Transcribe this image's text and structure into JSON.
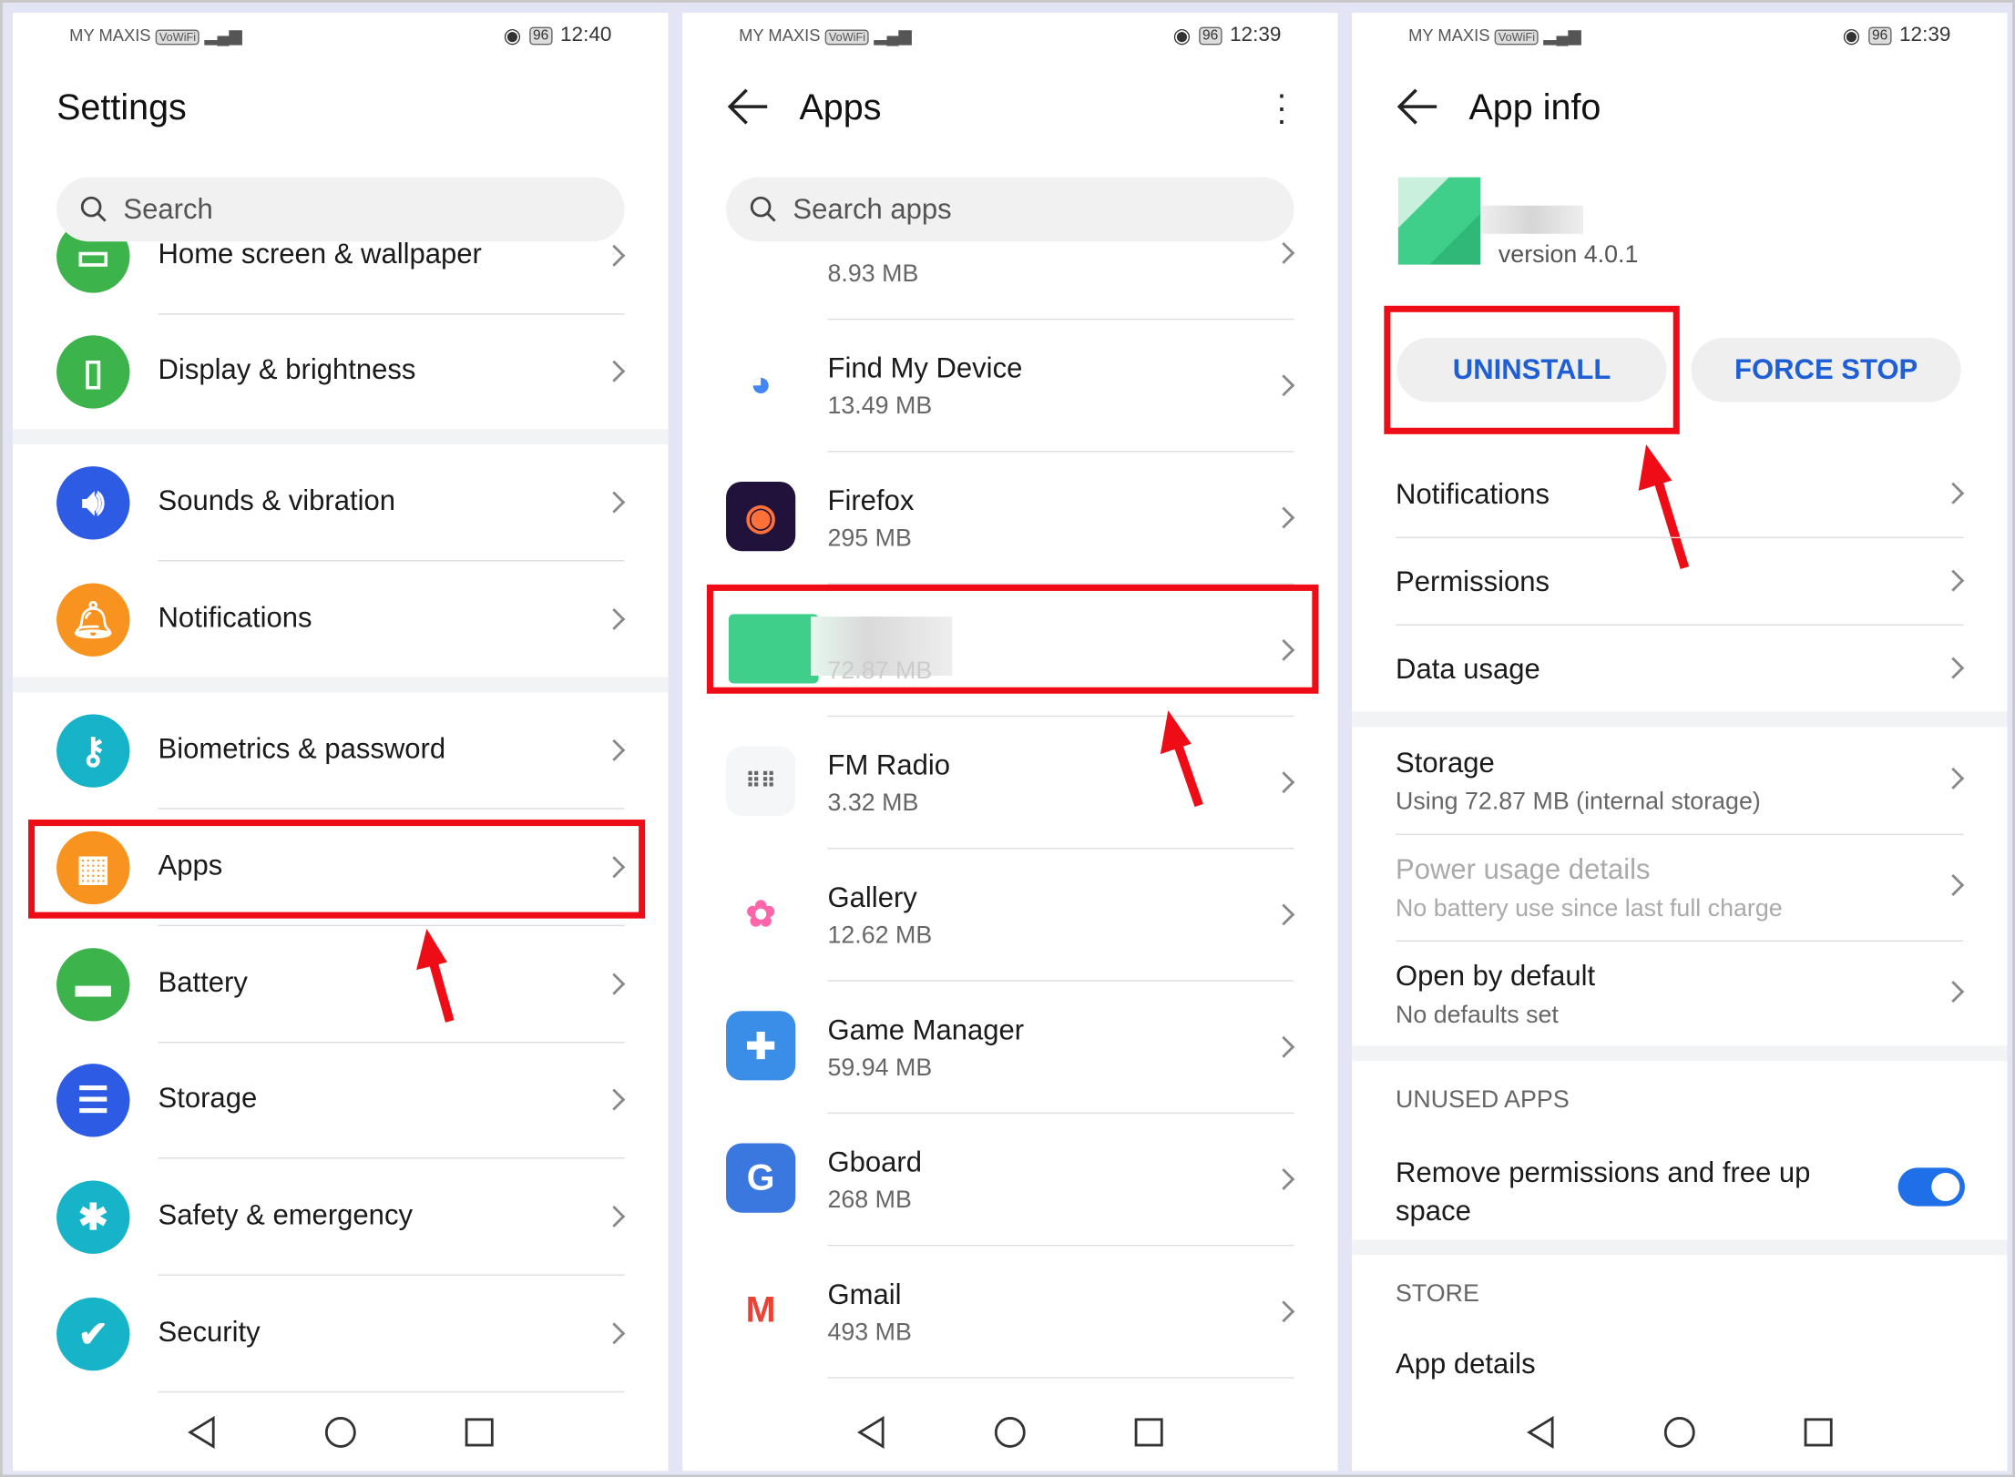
{
  "colors": {
    "accent": "#1f5fd6",
    "highlight": "#ee0d16",
    "toggle_on": "#1f6fe8"
  },
  "settings": {
    "status": {
      "carrier": "MY MAXIS",
      "wifi_badge": "VoWiFi",
      "battery": "96",
      "time": "12:40"
    },
    "title": "Settings",
    "search_placeholder": "Search",
    "items": [
      {
        "label": "Home screen & wallpaper",
        "icon": "home-screen-icon",
        "color": "#3cb44b"
      },
      {
        "label": "Display & brightness",
        "icon": "phone-brightness-icon",
        "color": "#3cb44b"
      },
      {
        "label": "Sounds & vibration",
        "icon": "speaker-icon",
        "color": "#2d5be3"
      },
      {
        "label": "Notifications",
        "icon": "bell-icon",
        "color": "#f7931e"
      },
      {
        "label": "Biometrics & password",
        "icon": "key-icon",
        "color": "#17b3c8"
      },
      {
        "label": "Apps",
        "icon": "apps-grid-icon",
        "color": "#f7931e"
      },
      {
        "label": "Battery",
        "icon": "battery-icon",
        "color": "#3cb44b"
      },
      {
        "label": "Storage",
        "icon": "storage-icon",
        "color": "#2d5be3"
      },
      {
        "label": "Safety & emergency",
        "icon": "asterisk-icon",
        "color": "#17b3c8"
      },
      {
        "label": "Security",
        "icon": "shield-icon",
        "color": "#17b3c8"
      }
    ]
  },
  "apps": {
    "status": {
      "carrier": "MY MAXIS",
      "wifi_badge": "VoWiFi",
      "battery": "96",
      "time": "12:39"
    },
    "title": "Apps",
    "search_placeholder": "Search apps",
    "items": [
      {
        "name": "",
        "size": "8.93 MB",
        "icon": "app-icon"
      },
      {
        "name": "Find My Device",
        "size": "13.49 MB",
        "icon": "find-my-device-icon"
      },
      {
        "name": "Firefox",
        "size": "295 MB",
        "icon": "firefox-icon"
      },
      {
        "name": "",
        "size": "72.87 MB",
        "icon": "blurred-app-icon"
      },
      {
        "name": "FM Radio",
        "size": "3.32 MB",
        "icon": "radio-icon"
      },
      {
        "name": "Gallery",
        "size": "12.62 MB",
        "icon": "gallery-icon"
      },
      {
        "name": "Game Manager",
        "size": "59.94 MB",
        "icon": "game-manager-icon"
      },
      {
        "name": "Gboard",
        "size": "268 MB",
        "icon": "gboard-icon"
      },
      {
        "name": "Gmail",
        "size": "493 MB",
        "icon": "gmail-icon"
      }
    ]
  },
  "appinfo": {
    "status": {
      "carrier": "MY MAXIS",
      "wifi_badge": "VoWiFi",
      "battery": "96",
      "time": "12:39"
    },
    "title": "App info",
    "version": "version 4.0.1",
    "uninstall": "UNINSTALL",
    "force_stop": "FORCE STOP",
    "notifications": "Notifications",
    "permissions": "Permissions",
    "data_usage": "Data usage",
    "storage": "Storage",
    "storage_sub": "Using 72.87 MB (internal storage)",
    "power": "Power usage details",
    "power_sub": "No battery use since last full charge",
    "open_default": "Open by default",
    "open_default_sub": "No defaults set",
    "unused_header": "UNUSED APPS",
    "remove_perms": "Remove permissions and free up space",
    "remove_perms_on": true,
    "store_header": "STORE",
    "app_details": "App details"
  }
}
